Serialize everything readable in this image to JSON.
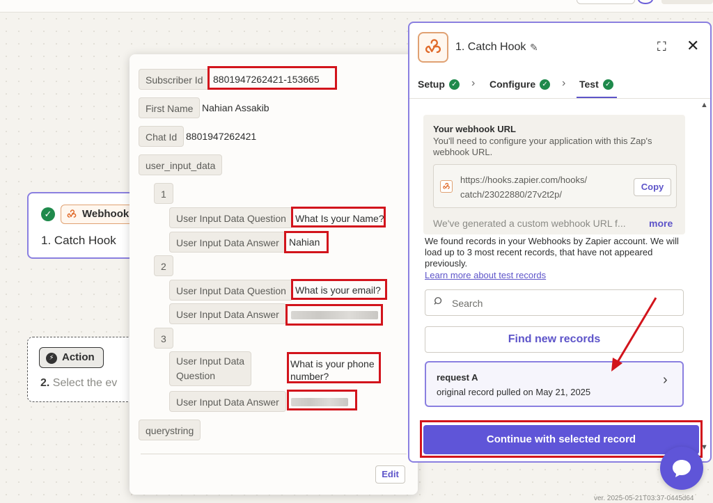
{
  "colors": {
    "accent": "#5f55d8",
    "success": "#1f8a4c",
    "highlight_red": "#d2141c",
    "webhook_orange": "#e0a172"
  },
  "canvas": {
    "trigger_node": {
      "app_label": "Webhooks",
      "title": "1. Catch Hook",
      "icon": "check-icon"
    },
    "action_node": {
      "chip_label": "Action",
      "step_number": "2.",
      "step_text": "Select the ev"
    }
  },
  "record_data": {
    "subscriber_id": {
      "label": "Subscriber Id",
      "value": "8801947262421-153665"
    },
    "first_name": {
      "label": "First Name",
      "value": "Nahian Assakib"
    },
    "chat_id": {
      "label": "Chat Id",
      "value": "8801947262421"
    },
    "user_input_data": {
      "label": "user_input_data",
      "items": [
        {
          "index": "1",
          "question_label": "User Input Data Question",
          "question": "What Is your Name?",
          "answer_label": "User Input Data Answer",
          "answer": "Nahian"
        },
        {
          "index": "2",
          "question_label": "User Input Data Question",
          "question": "What is your email?",
          "answer_label": "User Input Data Answer",
          "answer": ""
        },
        {
          "index": "3",
          "question_label_line1": "User Input Data",
          "question_label_line2": "Question",
          "question_line1": "What is your phone",
          "question_line2": "number?",
          "answer_label": "User Input Data Answer",
          "answer": ""
        }
      ]
    },
    "querystring": {
      "label": "querystring"
    },
    "edit_label": "Edit"
  },
  "panel": {
    "title": "1. Catch Hook",
    "tabs": [
      {
        "label": "Setup",
        "status": "complete"
      },
      {
        "label": "Configure",
        "status": "complete"
      },
      {
        "label": "Test",
        "status": "complete",
        "active": true
      }
    ],
    "webhook": {
      "heading": "Your webhook URL",
      "description": "You'll need to configure your application with this Zap's webhook URL.",
      "url_line1": "https://hooks.zapier.com/hooks/",
      "url_line2": "catch/23022880/27v2t2p/",
      "copy_label": "Copy",
      "generated_text": "We've generated a custom webhook URL f...",
      "more_label": "more"
    },
    "found_text": "We found records in your Webhooks by Zapier account. We will load up to 3 most recent records, that have not appeared previously.",
    "learn_more": "Learn more about test records",
    "search_placeholder": "Search",
    "find_new_records": "Find new records",
    "record": {
      "title": "request A",
      "subtitle": "original record pulled on May 21, 2025"
    },
    "continue_label": "Continue with selected record"
  },
  "footer": {
    "version": "ver. 2025-05-21T03:37-0445d64"
  }
}
